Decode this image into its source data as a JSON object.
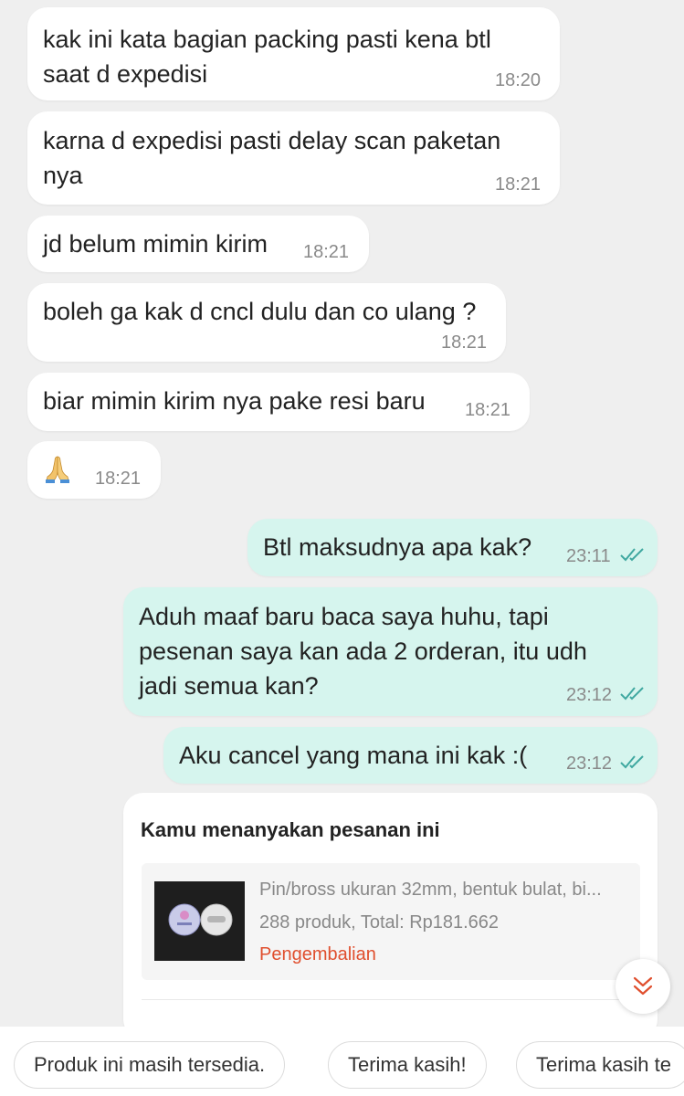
{
  "messages": [
    {
      "text": "kak ini kata bagian packing pasti kena btl\nsaat d expedisi",
      "time": "18:20",
      "direction": "incoming"
    },
    {
      "text": "karna d expedisi pasti delay scan paketan\nnya",
      "time": "18:21",
      "direction": "incoming"
    },
    {
      "text": "jd belum mimin kirim",
      "time": "18:21",
      "direction": "incoming"
    },
    {
      "text": "boleh ga kak d cncl dulu dan co ulang ?",
      "time": "18:21",
      "direction": "incoming"
    },
    {
      "text": "biar mimin kirim nya pake resi baru",
      "time": "18:21",
      "direction": "incoming"
    },
    {
      "emoji": "folded-hands-icon",
      "time": "18:21",
      "direction": "incoming"
    },
    {
      "text": "Btl maksudnya apa kak?",
      "time": "23:11",
      "direction": "outgoing",
      "status": "read"
    },
    {
      "text": "Aduh maaf baru baca saya huhu, tapi\npesenan saya kan ada 2 orderan, itu udh\njadi semua kan?",
      "time": "23:12",
      "direction": "outgoing",
      "status": "read"
    },
    {
      "text": "Aku cancel yang mana ini kak :(",
      "time": "23:12",
      "direction": "outgoing",
      "status": "read"
    }
  ],
  "product_card": {
    "title": "Kamu menanyakan pesanan ini",
    "product_name": "Pin/bross ukuran 32mm, bentuk bulat, bi...",
    "summary": "288 produk, Total: Rp181.662",
    "status": "Pengembalian"
  },
  "quick_replies": [
    "Produk ini masih tersedia.",
    "Terima kasih!",
    "Terima kasih te"
  ],
  "colors": {
    "background": "#efefef",
    "incoming_bubble": "#ffffff",
    "outgoing_bubble": "#d6f5ee",
    "read_ticks": "#3fa8a0",
    "status_text": "#e04f2e"
  }
}
